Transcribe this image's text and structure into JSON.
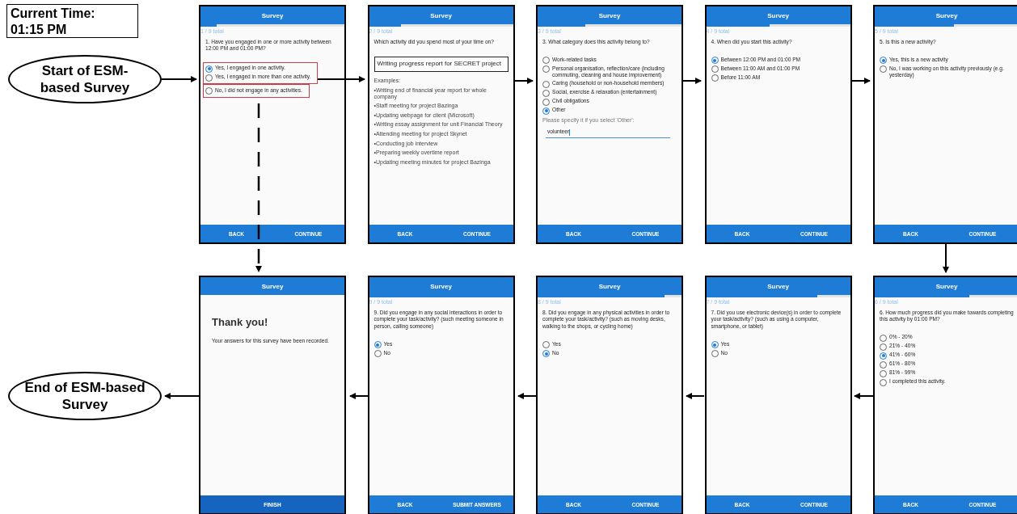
{
  "time_box": {
    "label": "Current Time:",
    "value": "01:15 PM"
  },
  "start_node": {
    "label": "Start of ESM-based Survey"
  },
  "end_node": {
    "label": "End of ESM-based Survey"
  },
  "screens": [
    {
      "kind": "choice",
      "title": "Survey",
      "progress_text": "1 / 9 total",
      "level": 0.11,
      "question": "1. Have you engaged in one or more activity between 12:00 PM and 01:00 PM?",
      "option_groups": [
        {
          "outlined": true,
          "options": [
            {
              "label": "Yes, I engaged in one activity.",
              "selected": true
            },
            {
              "label": "Yes, I engaged in more than one activity.",
              "selected": false
            }
          ]
        },
        {
          "outlined": true,
          "options": [
            {
              "label": "No, I did not engage in any activities.",
              "selected": false
            }
          ]
        }
      ],
      "buttons": [
        "BACK",
        "CONTINUE"
      ]
    },
    {
      "kind": "text_entry",
      "title": "Survey",
      "progress_text": "2 / 9 total",
      "level": 0.22,
      "question": "Which activity did you spend most of your time on?",
      "answer": "Writing progress report for SECRET project",
      "examples_label": "Examples:",
      "examples": [
        "•Writing end of financial year report for whole company",
        "•Staff meeting for project Bazinga",
        "•Updating webpage for client (Microsoft)",
        "•Writing essay assignment for unit Financial Theory",
        "•Attending meeting for project Skynet",
        "•Conducting job interview",
        "•Preparing weekly overtime report",
        "•Updating meeting minutes for project Bazinga"
      ],
      "buttons": [
        "BACK",
        "CONTINUE"
      ]
    },
    {
      "kind": "choice",
      "title": "Survey",
      "progress_text": "3 / 9 total",
      "level": 0.33,
      "question": "3. What category does this activity belong to?",
      "options": [
        {
          "label": "Work-related tasks",
          "selected": false
        },
        {
          "label": "Personal organisation, reflection/care (including commuting, cleaning and house improvement)",
          "selected": false
        },
        {
          "label": "Caring (household or non-household members)",
          "selected": false
        },
        {
          "label": "Social, exercise & relaxation (entertainment)",
          "selected": false
        },
        {
          "label": "Civil obligations",
          "selected": false
        },
        {
          "label": "Other",
          "selected": true
        }
      ],
      "specify_hint": "Please specify it if you select 'Other':",
      "specify_value": "volunteer",
      "buttons": [
        "BACK",
        "CONTINUE"
      ]
    },
    {
      "kind": "choice",
      "title": "Survey",
      "progress_text": "4 / 9 total",
      "level": 0.44,
      "question": "4. When did you start this activity?",
      "options": [
        {
          "label": "Between 12:00 PM and 01:00 PM",
          "selected": true
        },
        {
          "label": "Between 11:00 AM and 01:00 PM",
          "selected": false
        },
        {
          "label": "Before 11:00 AM",
          "selected": false
        }
      ],
      "buttons": [
        "BACK",
        "CONTINUE"
      ]
    },
    {
      "kind": "choice",
      "title": "Survey",
      "progress_text": "5 / 9 total",
      "level": 0.55,
      "question": "5. Is this a new activity?",
      "options": [
        {
          "label": "Yes, this is a new activity",
          "selected": true
        },
        {
          "label": "No, I was working on this activity previously (e.g. yesterday)",
          "selected": false
        }
      ],
      "buttons": [
        "BACK",
        "CONTINUE"
      ]
    },
    {
      "kind": "thanks",
      "title": "Survey",
      "heading": "Thank you!",
      "message": "Your answers for this survey have been recorded.",
      "buttons": [
        "FINISH"
      ]
    },
    {
      "kind": "choice",
      "title": "Survey",
      "progress_text": "9 / 9 total",
      "level": 1.0,
      "question": "9. Did you engage in any social interactions in order to complete your task/activity? (such meeting someone in person, calling someone)",
      "options": [
        {
          "label": "Yes",
          "selected": true
        },
        {
          "label": "No",
          "selected": false
        }
      ],
      "buttons": [
        "BACK",
        "SUBMIT ANSWERS"
      ]
    },
    {
      "kind": "choice",
      "title": "Survey",
      "progress_text": "8 / 9 total",
      "level": 0.88,
      "question": "8. Did you engage in any physical activities in order to complete your task/activity? (such as moving desks, walking to the shops, or cycling home)",
      "options": [
        {
          "label": "Yes",
          "selected": false
        },
        {
          "label": "No",
          "selected": true
        }
      ],
      "buttons": [
        "BACK",
        "CONTINUE"
      ]
    },
    {
      "kind": "choice",
      "title": "Survey",
      "progress_text": "7 / 9 total",
      "level": 0.77,
      "question": "7. Did you use electronic device(s) in order to complete your task/activity? (such as using a computer, smartphone, or tablet)",
      "options": [
        {
          "label": "Yes",
          "selected": true
        },
        {
          "label": "No",
          "selected": false
        }
      ],
      "buttons": [
        "BACK",
        "CONTINUE"
      ]
    },
    {
      "kind": "choice",
      "title": "Survey",
      "progress_text": "6 / 9 total",
      "level": 0.66,
      "question": "6. How much progress did you make towards completing this activity by 01:00 PM?",
      "options": [
        {
          "label": "0% - 20%",
          "selected": false
        },
        {
          "label": "21% - 40%",
          "selected": false
        },
        {
          "label": "41% - 60%",
          "selected": true
        },
        {
          "label": "61% - 80%",
          "selected": false
        },
        {
          "label": "81% - 99%",
          "selected": false
        },
        {
          "label": "I completed this activity.",
          "selected": false
        }
      ],
      "buttons": [
        "BACK",
        "CONTINUE"
      ]
    }
  ]
}
